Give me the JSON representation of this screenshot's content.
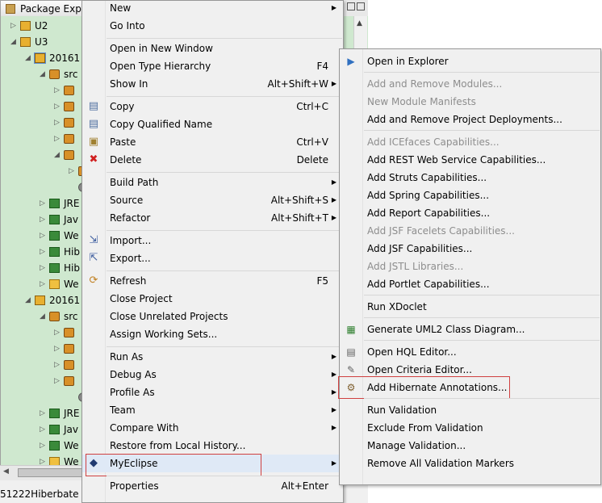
{
  "explorer": {
    "title": "Package Exp",
    "status_text": "51222Hiberbate",
    "tree": [
      {
        "text": "U2",
        "icon": "project-icon",
        "indent": 0,
        "twisty": "▷"
      },
      {
        "text": "U3",
        "icon": "project-icon",
        "indent": 0,
        "twisty": "◢"
      },
      {
        "text": "20161",
        "icon": "project-icon",
        "indent": 1,
        "twisty": "◢"
      },
      {
        "text": "src",
        "icon": "package-icon",
        "indent": 2,
        "twisty": "◢"
      },
      {
        "text": "",
        "icon": "package-icon",
        "indent": 3,
        "twisty": "▷"
      },
      {
        "text": "",
        "icon": "package-icon",
        "indent": 3,
        "twisty": "▷"
      },
      {
        "text": "",
        "icon": "package-icon",
        "indent": 3,
        "twisty": "▷"
      },
      {
        "text": "",
        "icon": "package-icon",
        "indent": 3,
        "twisty": "▷"
      },
      {
        "text": "",
        "icon": "package-icon",
        "indent": 3,
        "twisty": "◢"
      },
      {
        "text": "",
        "icon": "file-icon",
        "indent": 4,
        "twisty": "▷"
      },
      {
        "text": "",
        "icon": "gear-icon",
        "indent": 4,
        "twisty": ""
      },
      {
        "text": "JRE",
        "icon": "library-icon",
        "indent": 2,
        "twisty": "▷"
      },
      {
        "text": "Jav",
        "icon": "library-icon",
        "indent": 2,
        "twisty": "▷"
      },
      {
        "text": "We",
        "icon": "library-icon",
        "indent": 2,
        "twisty": "▷"
      },
      {
        "text": "Hib",
        "icon": "library-icon",
        "indent": 2,
        "twisty": "▷"
      },
      {
        "text": "Hib",
        "icon": "library-icon",
        "indent": 2,
        "twisty": "▷"
      },
      {
        "text": "We",
        "icon": "folder-icon",
        "indent": 2,
        "twisty": "▷"
      },
      {
        "text": "20161",
        "icon": "project-icon",
        "indent": 1,
        "twisty": "◢"
      },
      {
        "text": "src",
        "icon": "package-icon",
        "indent": 2,
        "twisty": "◢"
      },
      {
        "text": "",
        "icon": "package-icon",
        "indent": 3,
        "twisty": "▷"
      },
      {
        "text": "",
        "icon": "package-icon",
        "indent": 3,
        "twisty": "▷"
      },
      {
        "text": "",
        "icon": "package-icon",
        "indent": 3,
        "twisty": "▷"
      },
      {
        "text": "",
        "icon": "package-icon",
        "indent": 3,
        "twisty": "▷"
      },
      {
        "text": "",
        "icon": "gear-icon",
        "indent": 4,
        "twisty": ""
      },
      {
        "text": "JRE",
        "icon": "library-icon",
        "indent": 2,
        "twisty": "▷"
      },
      {
        "text": "Jav",
        "icon": "library-icon",
        "indent": 2,
        "twisty": "▷"
      },
      {
        "text": "We",
        "icon": "library-icon",
        "indent": 2,
        "twisty": "▷"
      },
      {
        "text": "We",
        "icon": "folder-icon",
        "indent": 2,
        "twisty": "▷"
      }
    ]
  },
  "menu": {
    "items": [
      {
        "label": "New",
        "shortcut": "",
        "submenu": true,
        "icon": ""
      },
      {
        "label": "Go Into",
        "shortcut": "",
        "submenu": false,
        "icon": ""
      },
      {
        "sep": true
      },
      {
        "label": "Open in New Window",
        "shortcut": "",
        "submenu": false,
        "icon": ""
      },
      {
        "label": "Open Type Hierarchy",
        "shortcut": "F4",
        "submenu": false,
        "icon": ""
      },
      {
        "label": "Show In",
        "shortcut": "Alt+Shift+W",
        "submenu": true,
        "icon": ""
      },
      {
        "sep": true
      },
      {
        "label": "Copy",
        "shortcut": "Ctrl+C",
        "submenu": false,
        "icon": "copy-icon"
      },
      {
        "label": "Copy Qualified Name",
        "shortcut": "",
        "submenu": false,
        "icon": "copy-qualified-icon"
      },
      {
        "label": "Paste",
        "shortcut": "Ctrl+V",
        "submenu": false,
        "icon": "paste-icon"
      },
      {
        "label": "Delete",
        "shortcut": "Delete",
        "submenu": false,
        "icon": "delete-icon"
      },
      {
        "sep": true
      },
      {
        "label": "Build Path",
        "shortcut": "",
        "submenu": true,
        "icon": ""
      },
      {
        "label": "Source",
        "shortcut": "Alt+Shift+S",
        "submenu": true,
        "icon": ""
      },
      {
        "label": "Refactor",
        "shortcut": "Alt+Shift+T",
        "submenu": true,
        "icon": ""
      },
      {
        "sep": true
      },
      {
        "label": "Import...",
        "shortcut": "",
        "submenu": false,
        "icon": "import-icon"
      },
      {
        "label": "Export...",
        "shortcut": "",
        "submenu": false,
        "icon": "export-icon"
      },
      {
        "sep": true
      },
      {
        "label": "Refresh",
        "shortcut": "F5",
        "submenu": false,
        "icon": "refresh-icon"
      },
      {
        "label": "Close Project",
        "shortcut": "",
        "submenu": false,
        "icon": ""
      },
      {
        "label": "Close Unrelated Projects",
        "shortcut": "",
        "submenu": false,
        "icon": ""
      },
      {
        "label": "Assign Working Sets...",
        "shortcut": "",
        "submenu": false,
        "icon": ""
      },
      {
        "sep": true
      },
      {
        "label": "Run As",
        "shortcut": "",
        "submenu": true,
        "icon": ""
      },
      {
        "label": "Debug As",
        "shortcut": "",
        "submenu": true,
        "icon": ""
      },
      {
        "label": "Profile As",
        "shortcut": "",
        "submenu": true,
        "icon": ""
      },
      {
        "label": "Team",
        "shortcut": "",
        "submenu": true,
        "icon": ""
      },
      {
        "label": "Compare With",
        "shortcut": "",
        "submenu": true,
        "icon": ""
      },
      {
        "label": "Restore from Local History...",
        "shortcut": "",
        "submenu": false,
        "icon": ""
      },
      {
        "label": "MyEclipse",
        "shortcut": "",
        "submenu": true,
        "icon": "myeclipse-icon",
        "highlight": true
      },
      {
        "sep": true
      },
      {
        "label": "Properties",
        "shortcut": "Alt+Enter",
        "submenu": false,
        "icon": ""
      }
    ]
  },
  "submenu": {
    "items": [
      {
        "label": "Open in Explorer",
        "disabled": false,
        "icon": "explorer-icon"
      },
      {
        "sep": true
      },
      {
        "label": "Add and Remove Modules...",
        "disabled": true,
        "icon": ""
      },
      {
        "label": "New Module Manifests",
        "disabled": true,
        "icon": ""
      },
      {
        "label": "Add and Remove Project Deployments...",
        "disabled": false,
        "icon": ""
      },
      {
        "sep": true
      },
      {
        "label": "Add ICEfaces Capabilities...",
        "disabled": true,
        "icon": ""
      },
      {
        "label": "Add REST Web Service Capabilities...",
        "disabled": false,
        "icon": ""
      },
      {
        "label": "Add Struts Capabilities...",
        "disabled": false,
        "icon": ""
      },
      {
        "label": "Add Spring Capabilities...",
        "disabled": false,
        "icon": ""
      },
      {
        "label": "Add Report Capabilities...",
        "disabled": false,
        "icon": ""
      },
      {
        "label": "Add JSF Facelets Capabilities...",
        "disabled": true,
        "icon": ""
      },
      {
        "label": "Add JSF Capabilities...",
        "disabled": false,
        "icon": ""
      },
      {
        "label": "Add JSTL Libraries...",
        "disabled": true,
        "icon": ""
      },
      {
        "label": "Add Portlet Capabilities...",
        "disabled": false,
        "icon": ""
      },
      {
        "sep": true
      },
      {
        "label": "Run XDoclet",
        "disabled": false,
        "icon": ""
      },
      {
        "sep": true
      },
      {
        "label": "Generate UML2 Class Diagram...",
        "disabled": false,
        "icon": "uml-icon"
      },
      {
        "sep": true
      },
      {
        "label": "Open HQL Editor...",
        "disabled": false,
        "icon": "hql-icon"
      },
      {
        "label": "Open Criteria Editor...",
        "disabled": false,
        "icon": "criteria-icon"
      },
      {
        "label": "Add Hibernate Annotations...",
        "disabled": false,
        "icon": "hibernate-icon",
        "boxed": true
      },
      {
        "sep": true
      },
      {
        "label": "Run Validation",
        "disabled": false,
        "icon": ""
      },
      {
        "label": "Exclude From Validation",
        "disabled": false,
        "icon": ""
      },
      {
        "label": "Manage Validation...",
        "disabled": false,
        "icon": ""
      },
      {
        "label": "Remove All Validation Markers",
        "disabled": false,
        "icon": ""
      }
    ]
  }
}
